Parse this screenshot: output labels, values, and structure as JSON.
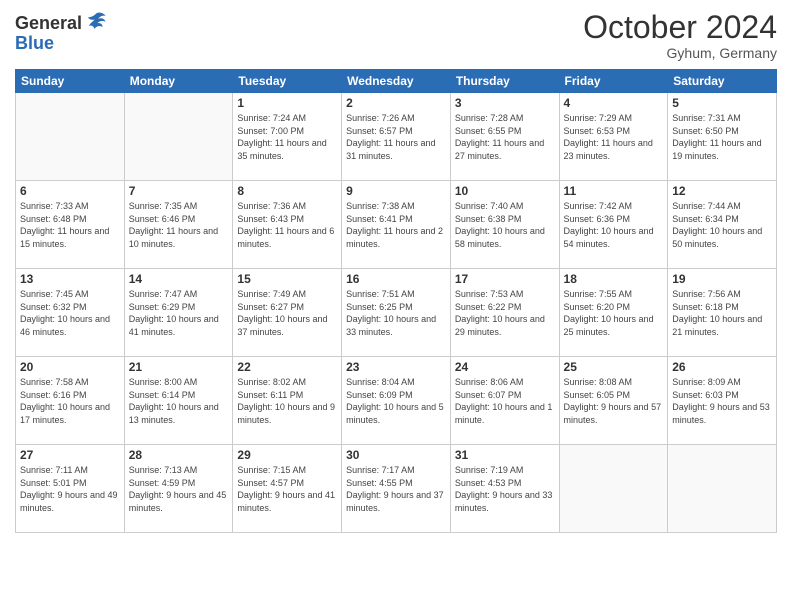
{
  "header": {
    "logo_general": "General",
    "logo_blue": "Blue",
    "title": "October 2024",
    "location": "Gyhum, Germany"
  },
  "days_of_week": [
    "Sunday",
    "Monday",
    "Tuesday",
    "Wednesday",
    "Thursday",
    "Friday",
    "Saturday"
  ],
  "weeks": [
    [
      {
        "day": "",
        "info": ""
      },
      {
        "day": "",
        "info": ""
      },
      {
        "day": "1",
        "info": "Sunrise: 7:24 AM\nSunset: 7:00 PM\nDaylight: 11 hours and 35 minutes."
      },
      {
        "day": "2",
        "info": "Sunrise: 7:26 AM\nSunset: 6:57 PM\nDaylight: 11 hours and 31 minutes."
      },
      {
        "day": "3",
        "info": "Sunrise: 7:28 AM\nSunset: 6:55 PM\nDaylight: 11 hours and 27 minutes."
      },
      {
        "day": "4",
        "info": "Sunrise: 7:29 AM\nSunset: 6:53 PM\nDaylight: 11 hours and 23 minutes."
      },
      {
        "day": "5",
        "info": "Sunrise: 7:31 AM\nSunset: 6:50 PM\nDaylight: 11 hours and 19 minutes."
      }
    ],
    [
      {
        "day": "6",
        "info": "Sunrise: 7:33 AM\nSunset: 6:48 PM\nDaylight: 11 hours and 15 minutes."
      },
      {
        "day": "7",
        "info": "Sunrise: 7:35 AM\nSunset: 6:46 PM\nDaylight: 11 hours and 10 minutes."
      },
      {
        "day": "8",
        "info": "Sunrise: 7:36 AM\nSunset: 6:43 PM\nDaylight: 11 hours and 6 minutes."
      },
      {
        "day": "9",
        "info": "Sunrise: 7:38 AM\nSunset: 6:41 PM\nDaylight: 11 hours and 2 minutes."
      },
      {
        "day": "10",
        "info": "Sunrise: 7:40 AM\nSunset: 6:38 PM\nDaylight: 10 hours and 58 minutes."
      },
      {
        "day": "11",
        "info": "Sunrise: 7:42 AM\nSunset: 6:36 PM\nDaylight: 10 hours and 54 minutes."
      },
      {
        "day": "12",
        "info": "Sunrise: 7:44 AM\nSunset: 6:34 PM\nDaylight: 10 hours and 50 minutes."
      }
    ],
    [
      {
        "day": "13",
        "info": "Sunrise: 7:45 AM\nSunset: 6:32 PM\nDaylight: 10 hours and 46 minutes."
      },
      {
        "day": "14",
        "info": "Sunrise: 7:47 AM\nSunset: 6:29 PM\nDaylight: 10 hours and 41 minutes."
      },
      {
        "day": "15",
        "info": "Sunrise: 7:49 AM\nSunset: 6:27 PM\nDaylight: 10 hours and 37 minutes."
      },
      {
        "day": "16",
        "info": "Sunrise: 7:51 AM\nSunset: 6:25 PM\nDaylight: 10 hours and 33 minutes."
      },
      {
        "day": "17",
        "info": "Sunrise: 7:53 AM\nSunset: 6:22 PM\nDaylight: 10 hours and 29 minutes."
      },
      {
        "day": "18",
        "info": "Sunrise: 7:55 AM\nSunset: 6:20 PM\nDaylight: 10 hours and 25 minutes."
      },
      {
        "day": "19",
        "info": "Sunrise: 7:56 AM\nSunset: 6:18 PM\nDaylight: 10 hours and 21 minutes."
      }
    ],
    [
      {
        "day": "20",
        "info": "Sunrise: 7:58 AM\nSunset: 6:16 PM\nDaylight: 10 hours and 17 minutes."
      },
      {
        "day": "21",
        "info": "Sunrise: 8:00 AM\nSunset: 6:14 PM\nDaylight: 10 hours and 13 minutes."
      },
      {
        "day": "22",
        "info": "Sunrise: 8:02 AM\nSunset: 6:11 PM\nDaylight: 10 hours and 9 minutes."
      },
      {
        "day": "23",
        "info": "Sunrise: 8:04 AM\nSunset: 6:09 PM\nDaylight: 10 hours and 5 minutes."
      },
      {
        "day": "24",
        "info": "Sunrise: 8:06 AM\nSunset: 6:07 PM\nDaylight: 10 hours and 1 minute."
      },
      {
        "day": "25",
        "info": "Sunrise: 8:08 AM\nSunset: 6:05 PM\nDaylight: 9 hours and 57 minutes."
      },
      {
        "day": "26",
        "info": "Sunrise: 8:09 AM\nSunset: 6:03 PM\nDaylight: 9 hours and 53 minutes."
      }
    ],
    [
      {
        "day": "27",
        "info": "Sunrise: 7:11 AM\nSunset: 5:01 PM\nDaylight: 9 hours and 49 minutes."
      },
      {
        "day": "28",
        "info": "Sunrise: 7:13 AM\nSunset: 4:59 PM\nDaylight: 9 hours and 45 minutes."
      },
      {
        "day": "29",
        "info": "Sunrise: 7:15 AM\nSunset: 4:57 PM\nDaylight: 9 hours and 41 minutes."
      },
      {
        "day": "30",
        "info": "Sunrise: 7:17 AM\nSunset: 4:55 PM\nDaylight: 9 hours and 37 minutes."
      },
      {
        "day": "31",
        "info": "Sunrise: 7:19 AM\nSunset: 4:53 PM\nDaylight: 9 hours and 33 minutes."
      },
      {
        "day": "",
        "info": ""
      },
      {
        "day": "",
        "info": ""
      }
    ]
  ]
}
